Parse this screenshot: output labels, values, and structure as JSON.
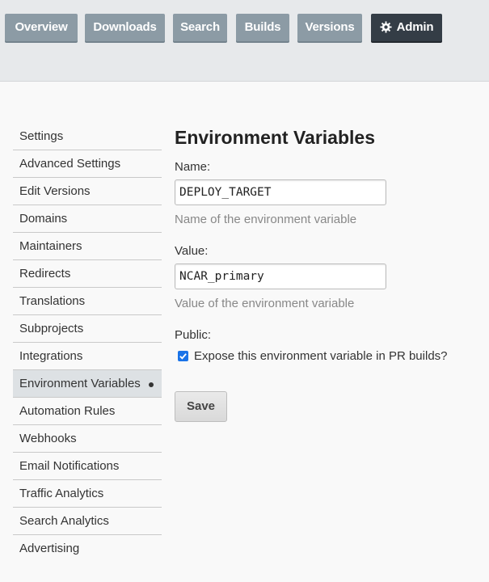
{
  "nav": {
    "tabs": [
      {
        "label": "Overview"
      },
      {
        "label": "Downloads"
      },
      {
        "label": "Search"
      },
      {
        "label": "Builds"
      },
      {
        "label": "Versions"
      },
      {
        "label": "Admin",
        "icon": "gear-icon",
        "active": true
      }
    ]
  },
  "sidebar": {
    "items": [
      {
        "label": "Settings"
      },
      {
        "label": "Advanced Settings"
      },
      {
        "label": "Edit Versions"
      },
      {
        "label": "Domains"
      },
      {
        "label": "Maintainers"
      },
      {
        "label": "Redirects"
      },
      {
        "label": "Translations"
      },
      {
        "label": "Subprojects"
      },
      {
        "label": "Integrations"
      },
      {
        "label": "Environment Variables",
        "active": true
      },
      {
        "label": "Automation Rules"
      },
      {
        "label": "Webhooks"
      },
      {
        "label": "Email Notifications"
      },
      {
        "label": "Traffic Analytics"
      },
      {
        "label": "Search Analytics"
      },
      {
        "label": "Advertising"
      }
    ]
  },
  "form": {
    "title": "Environment Variables",
    "name_label": "Name:",
    "name_value": "DEPLOY_TARGET",
    "name_help": "Name of the environment variable",
    "value_label": "Value:",
    "value_value": "NCAR_primary",
    "value_help": "Value of the environment variable",
    "public_label": "Public:",
    "public_checked": true,
    "public_checkbox_label": "Expose this environment variable in PR builds?",
    "save_label": "Save"
  },
  "colors": {
    "tab_bg": "#8c9ba5",
    "tab_active_bg": "#343d46",
    "checkbox_accent": "#1a73e8",
    "sidebar_active_bg": "#dde1e4"
  }
}
